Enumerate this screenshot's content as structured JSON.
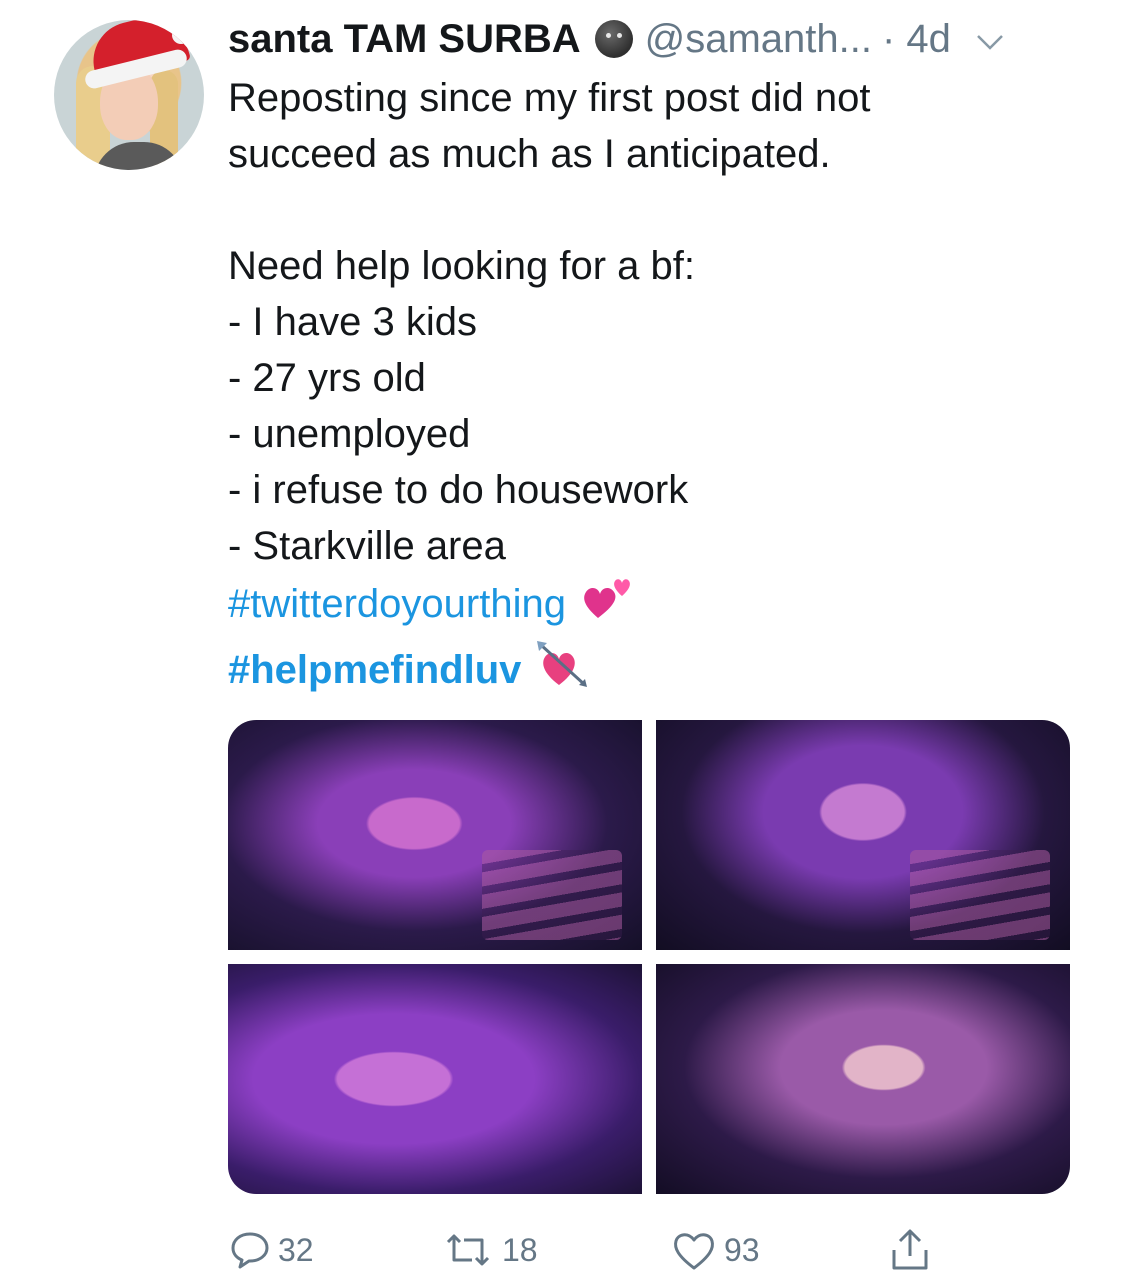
{
  "tweet": {
    "author_name": "santa TAM SURBA",
    "author_handle": "@samanth...",
    "time": "· 4d",
    "text_lines": [
      "Reposting since my first post did not",
      "succeed as much as I anticipated.",
      "",
      "Need help looking for a bf:",
      "- I have 3 kids",
      "- 27 yrs old",
      "- unemployed",
      "- i refuse to do housework",
      "- Starkville area"
    ],
    "hashtags": [
      "#twitterdoyourthing",
      "#helpmefindluv"
    ],
    "emojis": [
      "two-hearts-emoji",
      "heart-with-arrow-emoji"
    ]
  },
  "actions": {
    "replies": "32",
    "retweets": "18",
    "likes": "93"
  },
  "colors": {
    "link": "#1b95e0",
    "muted": "#657786",
    "text": "#14171a"
  }
}
